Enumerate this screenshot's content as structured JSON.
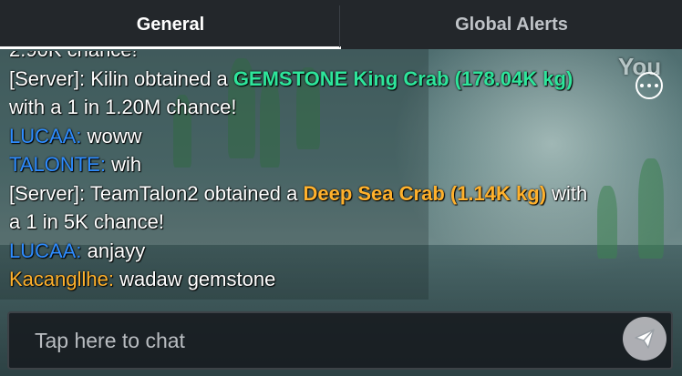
{
  "tabs": [
    {
      "label": "General",
      "active": true
    },
    {
      "label": "Global Alerts",
      "active": false
    }
  ],
  "chat": {
    "partial_top": "2.90K chance!",
    "messages": [
      {
        "speaker": "[Server]:",
        "text_before": " Kilin obtained a ",
        "highlight": "GEMSTONE King Crab (178.04K kg)",
        "text_after": " with a 1 in 1.20M chance!",
        "highlight_color": "#2ee59b"
      },
      {
        "speaker": "LUCAA:",
        "text": " woww"
      },
      {
        "speaker": "TALONTE:",
        "text": " wih"
      },
      {
        "speaker": "[Server]:",
        "text_before": " TeamTalon2 obtained a ",
        "highlight": "Deep Sea Crab (1.14K kg)",
        "text_after": " with a 1 in 5K chance!",
        "highlight_color": "#ffb12c"
      },
      {
        "speaker": "LUCAA:",
        "text": " anjayy"
      },
      {
        "speaker": "Kacangllhe:",
        "text": " wadaw gemstone"
      }
    ]
  },
  "corner_text": "You",
  "input": {
    "placeholder": "Tap here to chat"
  },
  "icons": {
    "menu": "more-options-icon",
    "send": "send-icon"
  },
  "colors": {
    "player_name": "#2e8cff",
    "server_rare": "#2ee59b",
    "server_uncommon": "#ffb12c"
  }
}
